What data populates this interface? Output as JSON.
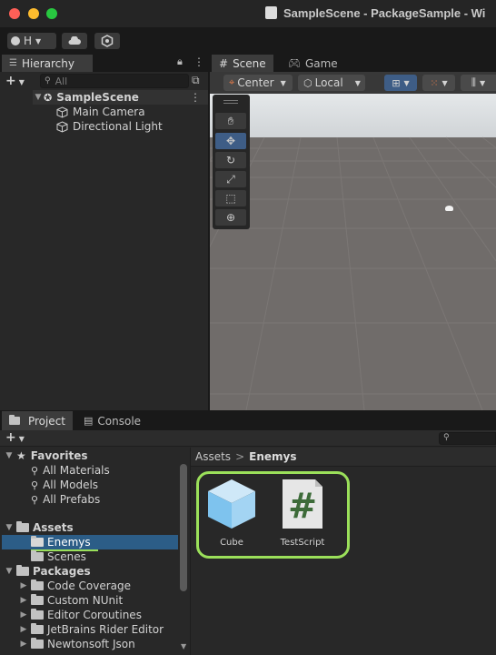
{
  "window": {
    "title": "SampleScene - PackageSample - Wi",
    "traffic_lights": [
      "#ff5f57",
      "#febc2e",
      "#28c840"
    ]
  },
  "toolbar": {
    "account_label": "H",
    "account_icon": "account-icon",
    "cloud_icon": "cloud-icon",
    "collab_icon": "collab-icon"
  },
  "hierarchy": {
    "tab_label": "Hierarchy",
    "search_placeholder": "All",
    "scene_name": "SampleScene",
    "items": [
      "Main Camera",
      "Directional Light"
    ]
  },
  "scene_view": {
    "tabs": [
      {
        "label": "Scene",
        "icon": "grid-icon"
      },
      {
        "label": "Game",
        "icon": "gamepad-icon"
      }
    ],
    "pivot_label": "Center",
    "space_label": "Local",
    "tools": [
      "view-hand",
      "move",
      "rotate",
      "scale",
      "rect",
      "transform"
    ],
    "sky_color": "#d9dde0",
    "ground_color": "#706c6a"
  },
  "project": {
    "tabs": [
      {
        "label": "Project",
        "icon": "folder-icon"
      },
      {
        "label": "Console",
        "icon": "console-icon"
      }
    ],
    "favorites_label": "Favorites",
    "favorites": [
      "All Materials",
      "All Models",
      "All Prefabs"
    ],
    "assets_label": "Assets",
    "asset_folders": [
      "Enemys",
      "Scenes"
    ],
    "selected_folder": "Enemys",
    "packages_label": "Packages",
    "packages": [
      "Code Coverage",
      "Custom NUnit",
      "Editor Coroutines",
      "JetBrains Rider Editor",
      "Newtonsoft Json"
    ],
    "breadcrumb": {
      "root": "Assets",
      "separator": ">",
      "current": "Enemys"
    },
    "files": [
      {
        "name": "Cube",
        "icon": "cube-icon"
      },
      {
        "name": "TestScript",
        "icon": "csharp-script-icon"
      }
    ],
    "highlight_color": "#9be05a",
    "selection_color": "#2c5d87"
  }
}
